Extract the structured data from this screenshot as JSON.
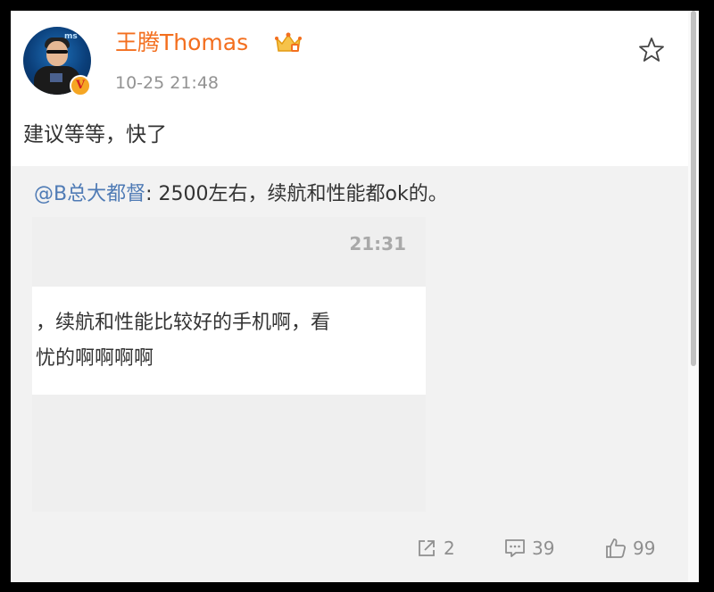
{
  "post": {
    "author": {
      "name": "王腾Thomas",
      "avatar_text": "ms",
      "verified_badge_text": "V"
    },
    "time": "10-25 21:48",
    "text": "建议等等，快了",
    "repost": {
      "mention": "@B总大都督",
      "text": ": 2500左右，续航和性能都ok的。",
      "image": {
        "time": "21:31",
        "line1": "，续航和性能比较好的手机啊，看",
        "line2": "忧的啊啊啊啊"
      }
    },
    "actions": {
      "repost_count": "2",
      "comment_count": "39",
      "like_count": "99"
    }
  },
  "colors": {
    "username": "#f36f1f",
    "mention": "#4f7bb5",
    "muted": "#939393"
  },
  "icons": [
    "crown-vip-icon",
    "star-icon",
    "share-icon",
    "comment-icon",
    "like-icon"
  ]
}
